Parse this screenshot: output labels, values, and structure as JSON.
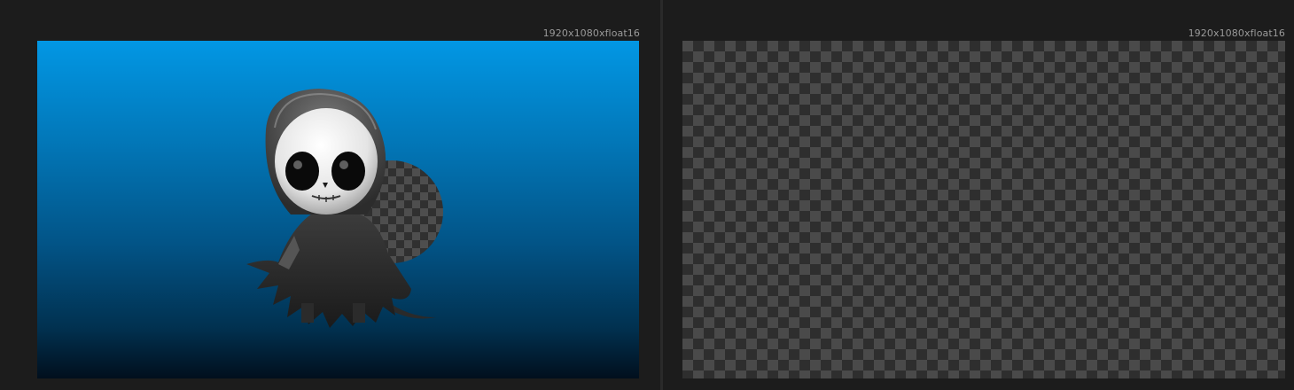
{
  "left_viewer": {
    "resolution_label": "1920x1080xfloat16",
    "background_gradient": [
      "#0297e4",
      "#010f1d"
    ]
  },
  "right_viewer": {
    "resolution_label": "1920x1080xfloat16",
    "checker_colors": [
      "#4a4a4a",
      "#2e2e2e"
    ]
  },
  "colors": {
    "app_background": "#1b1b1b",
    "divider": "#2a2a2a",
    "sphere": "#e6e27a"
  }
}
